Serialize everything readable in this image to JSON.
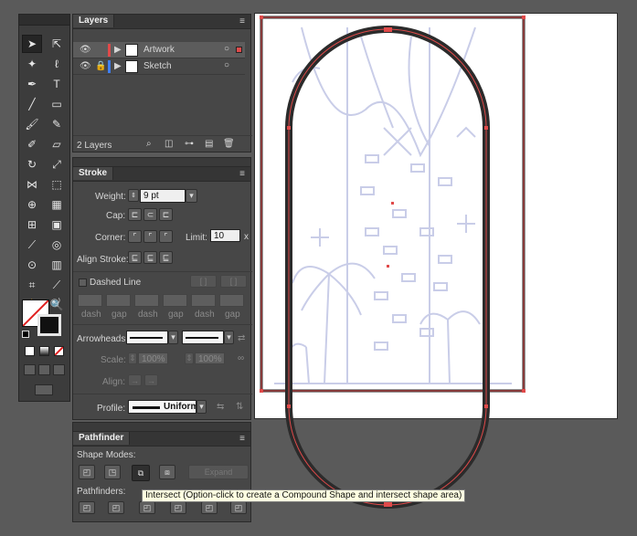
{
  "layers_panel": {
    "tab": "Layers",
    "rows": [
      {
        "name": "Artwork",
        "color": "#e04a4a",
        "selected": true
      },
      {
        "name": "Sketch",
        "color": "#3f7ff0",
        "selected": false
      }
    ],
    "count": "2 Layers"
  },
  "stroke_panel": {
    "tab": "Stroke",
    "weight_label": "Weight:",
    "weight_value": "9 pt",
    "cap_label": "Cap:",
    "corner_label": "Corner:",
    "limit_label": "Limit:",
    "limit_value": "10",
    "limit_unit": "x",
    "align_label": "Align Stroke:",
    "dashed_label": "Dashed Line",
    "dash_labels": [
      "dash",
      "gap",
      "dash",
      "gap",
      "dash",
      "gap"
    ],
    "arrowheads_label": "Arrowheads:",
    "scale_label": "Scale:",
    "scale_value_1": "100%",
    "scale_value_2": "100%",
    "align_arrow_label": "Align:",
    "profile_label": "Profile:",
    "profile_value": "Uniform"
  },
  "pathfinder_panel": {
    "tab": "Pathfinder",
    "shape_modes_label": "Shape Modes:",
    "expand_label": "Expand",
    "pathfinders_label": "Pathfinders:"
  },
  "tooltip": "Intersect (Option-click to create a Compound Shape and intersect shape area)",
  "colors": {
    "panel_bg": "#474747",
    "selection_red": "#e04a4a",
    "sketch_blue": "#3f7ff0",
    "sketch_lines": "#c9cde8",
    "shape_stroke": "#2b2b2b"
  }
}
